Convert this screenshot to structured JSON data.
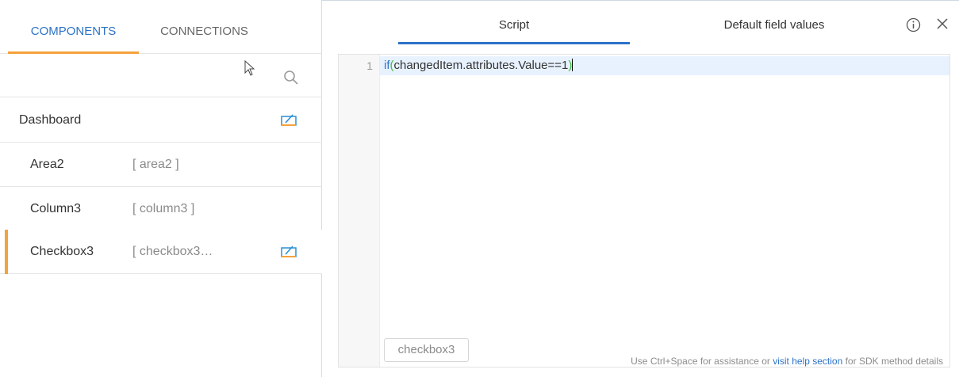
{
  "left_tabs": [
    {
      "label": "COMPONENTS"
    },
    {
      "label": "CONNECTIONS"
    }
  ],
  "tree": [
    {
      "name": "Dashboard",
      "id": "",
      "edit_icon": "edit-display-icon"
    },
    {
      "name": "Area2",
      "id": "[ area2 ]"
    },
    {
      "name": "Column3",
      "id": "[ column3 ]"
    },
    {
      "name": "Checkbox3",
      "id": "[ checkbox3…",
      "edit_icon": "edit-display-icon",
      "selected": true
    }
  ],
  "right_tabs": [
    {
      "label": "Script"
    },
    {
      "label": "Default field values"
    }
  ],
  "editor": {
    "line_number": "1",
    "code_keyword": "if",
    "code_open": "(",
    "code_body": "changedItem.attributes.Value==1",
    "code_close": ")",
    "chip_label": "checkbox3",
    "hint_prefix": "Use Ctrl+Space for assistance or ",
    "hint_link": "visit help section",
    "hint_suffix": " for SDK method details"
  },
  "icons": {
    "search": "search-icon",
    "info": "info-icon",
    "close": "close-icon",
    "cursor": "mouse-cursor-icon"
  },
  "colors": {
    "accent_blue": "#2b72c7",
    "accent_orange": "#f4a23c",
    "paren_green": "#3fbf3f",
    "edit_icon_blue": "#2b8fd6"
  }
}
